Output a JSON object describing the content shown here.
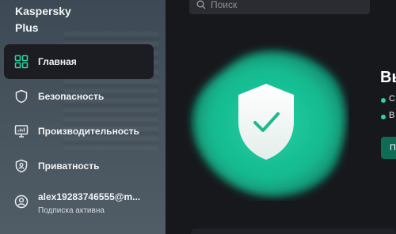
{
  "app": {
    "brand_line1": "Kaspersky",
    "brand_line2": "Plus"
  },
  "sidebar": {
    "items": [
      {
        "label": "Главная",
        "icon": "dashboard-icon",
        "active": true
      },
      {
        "label": "Безопасность",
        "icon": "shield-icon",
        "active": false
      },
      {
        "label": "Производительность",
        "icon": "monitor-icon",
        "active": false
      },
      {
        "label": "Приватность",
        "icon": "privacy-shield-icon",
        "active": false
      }
    ],
    "account": {
      "name": "alex19283746555@m...",
      "status": "Подписка активна",
      "icon": "user-icon"
    }
  },
  "search": {
    "placeholder": "Поиск"
  },
  "main": {
    "heading": "Вы",
    "bullets": [
      "С",
      "В"
    ],
    "cta_label": "П"
  },
  "colors": {
    "accent": "#2fd3a0",
    "cta": "#0f6b55",
    "sidebar_active": "#1c1d22"
  }
}
